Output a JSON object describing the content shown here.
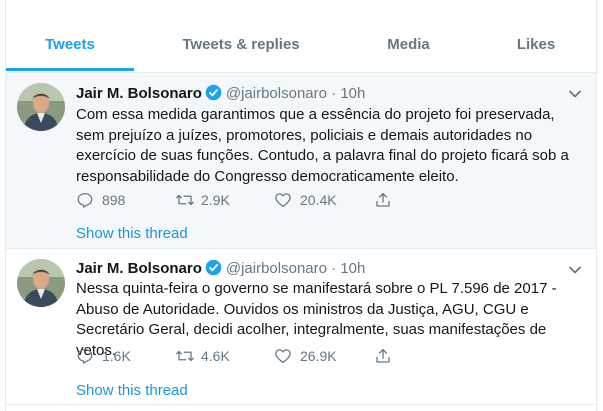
{
  "tabs": [
    "Tweets",
    "Tweets & replies",
    "Media",
    "Likes"
  ],
  "colors": {
    "accent": "#1da1f2",
    "muted": "#657786",
    "highlight_bg": "#f5f8fa",
    "link": "#1b95e0"
  },
  "tweets": [
    {
      "name": "Jair M. Bolsonaro",
      "handle": "@jairbolsonaro",
      "separator": "·",
      "time": "10h",
      "text": "Com essa medida garantimos que a essência do projeto foi preservada, sem prejuízo a juízes, promotores, policiais e demais autoridades no exercício de suas funções. Contudo, a palavra final do projeto ficará sob a responsabilidade do Congresso democraticamente eleito.",
      "replies": "898",
      "retweets": "2.9K",
      "likes": "20.4K",
      "show_thread": "Show this thread"
    },
    {
      "name": "Jair M. Bolsonaro",
      "handle": "@jairbolsonaro",
      "separator": "·",
      "time": "10h",
      "text": "Nessa quinta-feira o governo se manifestará sobre o PL 7.596 de 2017 - Abuso de Autoridade. Ouvidos os ministros da Justiça, AGU, CGU e Secretário Geral, decidi acolher, integralmente, suas manifestações de vetos.",
      "replies": "1.6K",
      "retweets": "4.6K",
      "likes": "26.9K",
      "show_thread": "Show this thread"
    }
  ]
}
